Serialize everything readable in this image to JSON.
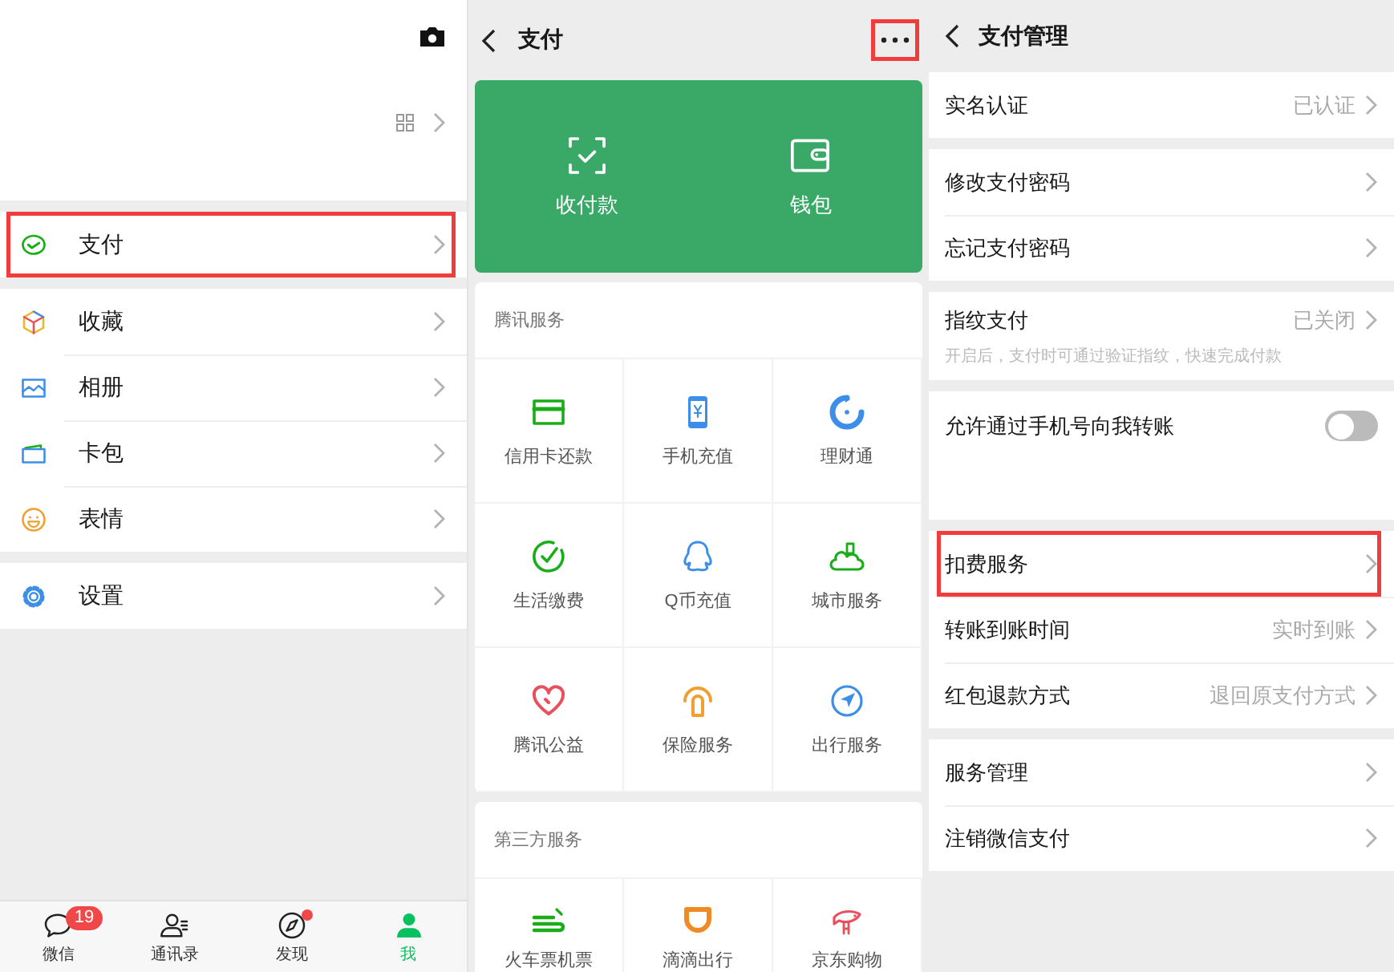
{
  "me_screen": {
    "menu_groups": [
      [
        {
          "label": "支付",
          "kind": "pay",
          "highlighted": true
        }
      ],
      [
        {
          "label": "收藏",
          "kind": "favorites",
          "highlighted": false
        },
        {
          "label": "相册",
          "kind": "album",
          "highlighted": false
        },
        {
          "label": "卡包",
          "kind": "cards",
          "highlighted": false
        },
        {
          "label": "表情",
          "kind": "stickers",
          "highlighted": false
        }
      ],
      [
        {
          "label": "设置",
          "kind": "settings",
          "highlighted": false
        }
      ]
    ],
    "tab_bar": [
      {
        "label": "微信",
        "kind": "chats",
        "badge": "19",
        "dot": false,
        "selected": false
      },
      {
        "label": "通讯录",
        "kind": "contacts",
        "dot": false,
        "selected": false
      },
      {
        "label": "发现",
        "kind": "discover",
        "dot": true,
        "selected": false
      },
      {
        "label": "我",
        "kind": "me",
        "dot": false,
        "selected": true
      }
    ]
  },
  "pay_screen": {
    "title": "支付",
    "more_highlighted": true,
    "top_actions": [
      {
        "label": "收付款",
        "kind": "scan"
      },
      {
        "label": "钱包",
        "kind": "wallet"
      }
    ],
    "sections": [
      {
        "title": "腾讯服务",
        "items": [
          {
            "label": "信用卡还款",
            "kind": "card"
          },
          {
            "label": "手机充值",
            "kind": "phone"
          },
          {
            "label": "理财通",
            "kind": "swirl"
          },
          {
            "label": "生活缴费",
            "kind": "check"
          },
          {
            "label": "Q币充值",
            "kind": "penguin"
          },
          {
            "label": "城市服务",
            "kind": "city"
          },
          {
            "label": "腾讯公益",
            "kind": "heart"
          },
          {
            "label": "保险服务",
            "kind": "umbrella"
          },
          {
            "label": "出行服务",
            "kind": "navigate"
          }
        ]
      },
      {
        "title": "第三方服务",
        "items": [
          {
            "label": "火车票机票",
            "kind": "train"
          },
          {
            "label": "滴滴出行",
            "kind": "cup"
          },
          {
            "label": "京东购物",
            "kind": "fish"
          }
        ]
      }
    ]
  },
  "pay_settings_screen": {
    "title": "支付管理",
    "groups": [
      [
        {
          "label": "实名认证",
          "kind": "link",
          "value": "已认证",
          "highlighted": false
        }
      ],
      [
        {
          "label": "修改支付密码",
          "kind": "link",
          "highlighted": false
        },
        {
          "label": "忘记支付密码",
          "kind": "link",
          "highlighted": false
        }
      ],
      [
        {
          "label": "指纹支付",
          "kind": "link",
          "value": "已关闭",
          "description": "开启后，支付时可通过验证指纹，快速完成付款",
          "highlighted": false
        }
      ],
      [
        {
          "label": "允许通过手机号向我转账",
          "kind": "toggle",
          "on": false
        }
      ],
      [
        {
          "label": "扣费服务",
          "kind": "link",
          "highlighted": true
        },
        {
          "label": "转账到账时间",
          "kind": "link",
          "value": "实时到账",
          "highlighted": false
        },
        {
          "label": "红包退款方式",
          "kind": "link",
          "value": "退回原支付方式",
          "highlighted": false
        }
      ],
      [
        {
          "label": "服务管理",
          "kind": "link",
          "highlighted": false
        },
        {
          "label": "注销微信支付",
          "kind": "link",
          "highlighted": false
        }
      ]
    ]
  }
}
